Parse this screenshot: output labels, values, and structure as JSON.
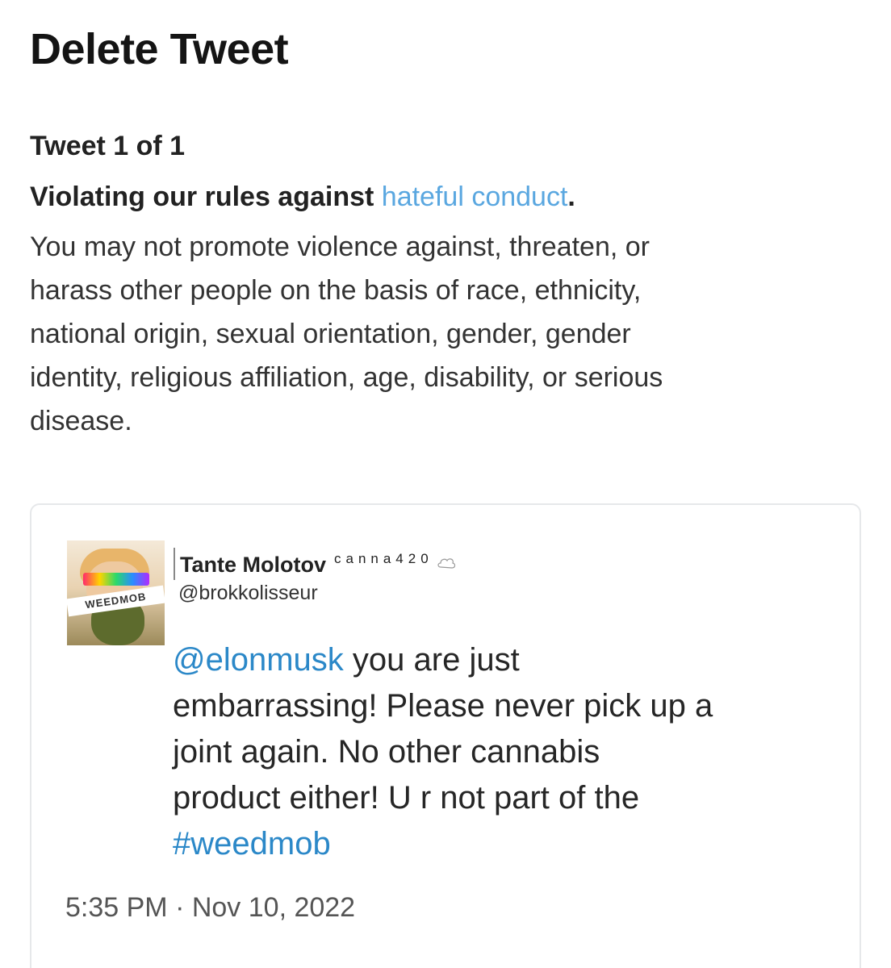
{
  "header": {
    "title": "Delete Tweet"
  },
  "notice": {
    "counter": "Tweet 1 of 1",
    "rule_prefix": "Violating our rules against ",
    "rule_link": "hateful conduct",
    "rule_suffix": ".",
    "body_lines": [
      "You may not promote violence against, threaten, or",
      "harass other people on the basis of race, ethnicity,",
      "national origin, sexual orientation, gender, gender",
      "identity, religious affiliation, age, disability, or serious",
      "disease."
    ]
  },
  "tweet": {
    "display_name": "Tante Molotov",
    "name_suffix": "canna420",
    "handle": "@brokkolisseur",
    "avatar_banner_text": "WEEDMOB",
    "text": {
      "mention": "@elonmusk",
      "line1_rest": " you are just",
      "line2": "embarrassing! Please never pick up a",
      "line3": "joint again. No other cannabis",
      "line4": "product either! U r not part of the",
      "hashtag": "#weedmob"
    },
    "timestamp": "5:35 PM · Nov 10, 2022"
  }
}
